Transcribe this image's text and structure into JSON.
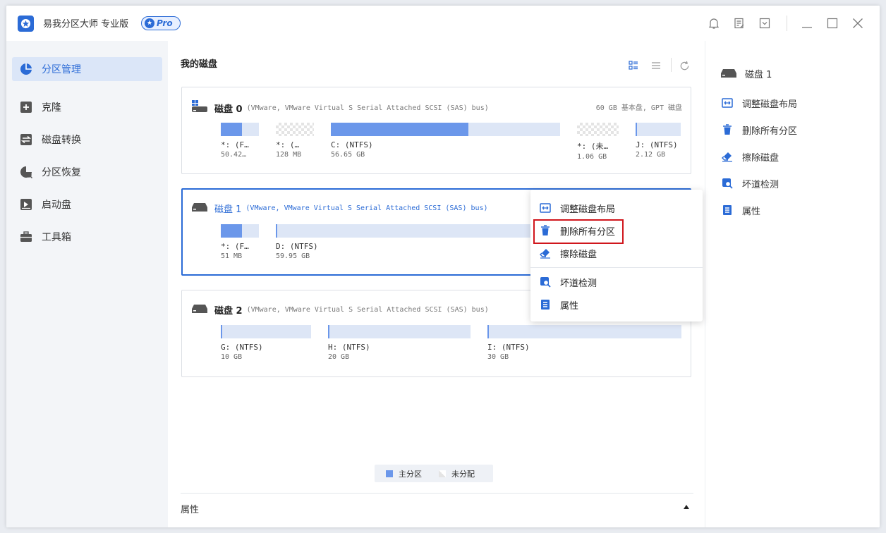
{
  "titlebar": {
    "app_name": "易我分区大师 专业版",
    "badge": "Pro"
  },
  "sidebar": {
    "items": [
      {
        "label": "分区管理",
        "icon": "pie-chart-icon",
        "active": true
      },
      {
        "label": "克隆",
        "icon": "clone-icon"
      },
      {
        "label": "磁盘转换",
        "icon": "convert-icon"
      },
      {
        "label": "分区恢复",
        "icon": "recovery-icon"
      },
      {
        "label": "启动盘",
        "icon": "bootable-disk-icon"
      },
      {
        "label": "工具箱",
        "icon": "toolbox-icon"
      }
    ]
  },
  "main": {
    "title": "我的磁盘",
    "disks": [
      {
        "name": "磁盘 0",
        "desc": "(VMware,  VMware Virtual S Serial Attached SCSI (SAS) bus)",
        "info": "60 GB 基本盘, GPT 磁盘",
        "partitions": [
          {
            "label": "*: (F…",
            "size": "50.42…",
            "fill": 0.55,
            "type": "primary"
          },
          {
            "label": "*: (…",
            "size": "128 MB",
            "fill": 0,
            "type": "unallocated"
          },
          {
            "label": "C: (NTFS)",
            "size": "56.65 GB",
            "fill": 0.6,
            "type": "primary"
          },
          {
            "label": "*: (未…",
            "size": "1.06 GB",
            "fill": 0,
            "type": "unallocated"
          },
          {
            "label": "J: (NTFS)",
            "size": "2.12 GB",
            "fill": 0.02,
            "type": "primary"
          }
        ]
      },
      {
        "name": "磁盘 1",
        "desc": "(VMware,  VMware Virtual S Serial Attached SCSI (SAS) bus)",
        "partitions": [
          {
            "label": "*: (F…",
            "size": "51 MB",
            "fill": 0.55,
            "type": "primary"
          },
          {
            "label": "D: (NTFS)",
            "size": "59.95 GB",
            "fill": 0.005,
            "type": "primary"
          }
        ]
      },
      {
        "name": "磁盘 2",
        "desc": "(VMware,  VMware Virtual S Serial Attached SCSI (SAS) bus)",
        "partitions": [
          {
            "label": "G: (NTFS)",
            "size": "10 GB",
            "fill": 0.01,
            "type": "primary"
          },
          {
            "label": "H: (NTFS)",
            "size": "20 GB",
            "fill": 0.01,
            "type": "primary"
          },
          {
            "label": "I: (NTFS)",
            "size": "30 GB",
            "fill": 0.005,
            "type": "primary"
          }
        ]
      }
    ],
    "legend": {
      "primary": "主分区",
      "unallocated": "未分配"
    },
    "properties_label": "属性"
  },
  "right_panel": {
    "disk_label": "磁盘 1",
    "actions": [
      "调整磁盘布局",
      "删除所有分区",
      "擦除磁盘",
      "坏道检测",
      "属性"
    ]
  },
  "context_menu": {
    "items": [
      "调整磁盘布局",
      "删除所有分区",
      "擦除磁盘",
      "坏道检测",
      "属性"
    ],
    "highlighted": "删除所有分区"
  },
  "colors": {
    "accent": "#2b6bd6",
    "partition_fill": "#6b97ea",
    "partition_bg": "#dde6f6",
    "highlight_border": "#d0161c"
  }
}
